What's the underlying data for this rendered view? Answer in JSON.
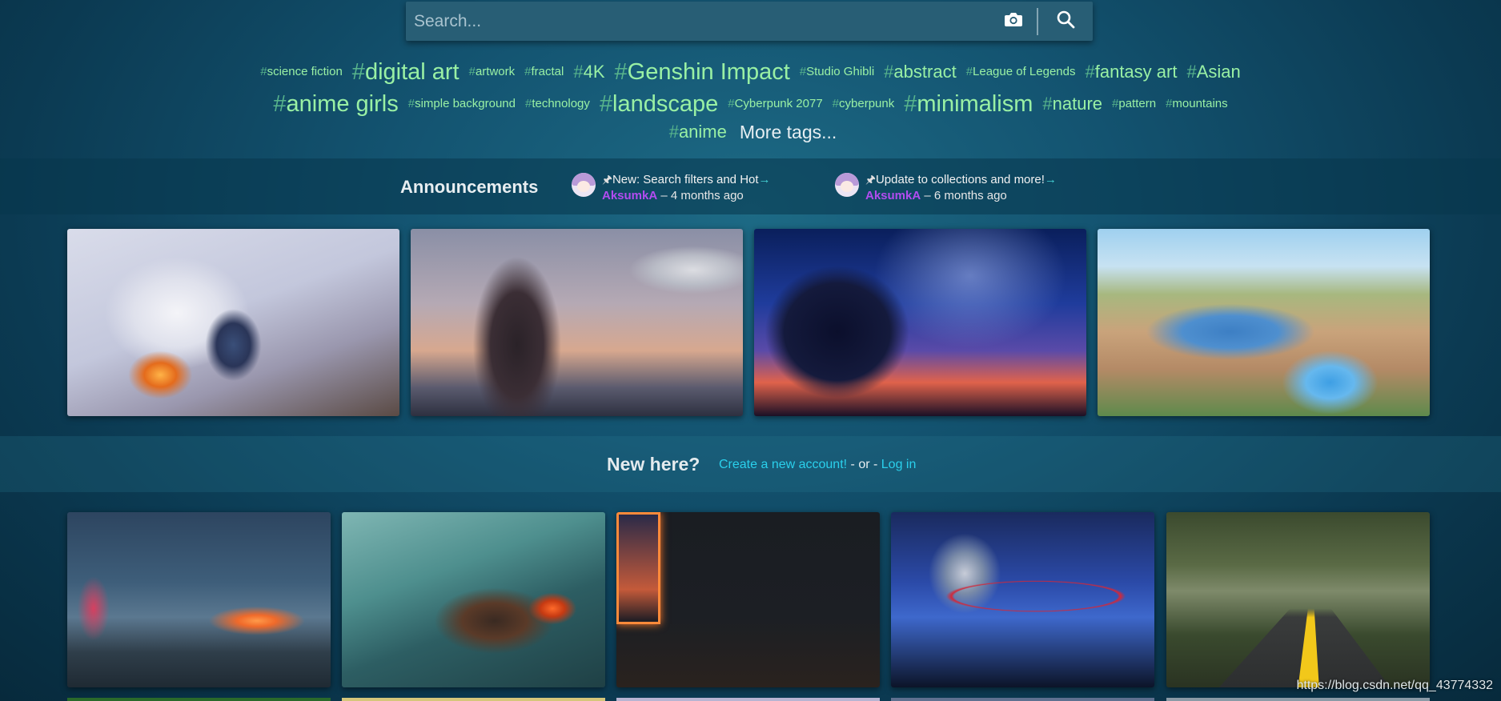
{
  "search": {
    "placeholder": "Search...",
    "icons": {
      "camera": "camera-icon",
      "search": "magnifier-icon"
    }
  },
  "tags": {
    "line1": [
      {
        "label": "science fiction",
        "size": "s"
      },
      {
        "label": "digital art",
        "size": "xl"
      },
      {
        "label": "artwork",
        "size": "s"
      },
      {
        "label": "fractal",
        "size": "s"
      },
      {
        "label": "4K",
        "size": "l"
      },
      {
        "label": "Genshin Impact",
        "size": "xl"
      },
      {
        "label": "Studio Ghibli",
        "size": "s"
      },
      {
        "label": "abstract",
        "size": "l"
      },
      {
        "label": "League of Legends",
        "size": "s"
      },
      {
        "label": "fantasy art",
        "size": "l"
      },
      {
        "label": "Asian",
        "size": "l"
      }
    ],
    "line2": [
      {
        "label": "anime girls",
        "size": "xl"
      },
      {
        "label": "simple background",
        "size": "s"
      },
      {
        "label": "technology",
        "size": "s"
      },
      {
        "label": "landscape",
        "size": "xl"
      },
      {
        "label": "Cyberpunk 2077",
        "size": "s"
      },
      {
        "label": "cyberpunk",
        "size": "s"
      },
      {
        "label": "minimalism",
        "size": "xl"
      },
      {
        "label": "nature",
        "size": "l"
      },
      {
        "label": "pattern",
        "size": "s"
      },
      {
        "label": "mountains",
        "size": "s"
      }
    ],
    "line3": [
      {
        "label": "anime",
        "size": "l"
      }
    ],
    "more_label": "More tags..."
  },
  "announcements": {
    "title": "Announcements",
    "items": [
      {
        "title": "New: Search filters and Hot",
        "author": "AksumkA",
        "ago": "– 4 months ago"
      },
      {
        "title": "Update to collections and more!",
        "author": "AksumkA",
        "ago": "– 6 months ago"
      }
    ]
  },
  "new_here": {
    "title": "New here?",
    "create_label": "Create a new account!",
    "or_label": " - or - ",
    "login_label": "Log in"
  },
  "watermark": "https://blog.csdn.net/qq_43774332",
  "colors": {
    "tag": "#99f0a4",
    "hash": "#58b58c",
    "author": "#b24cf0",
    "link": "#2ad0ec",
    "search_bg": "#285e75"
  }
}
